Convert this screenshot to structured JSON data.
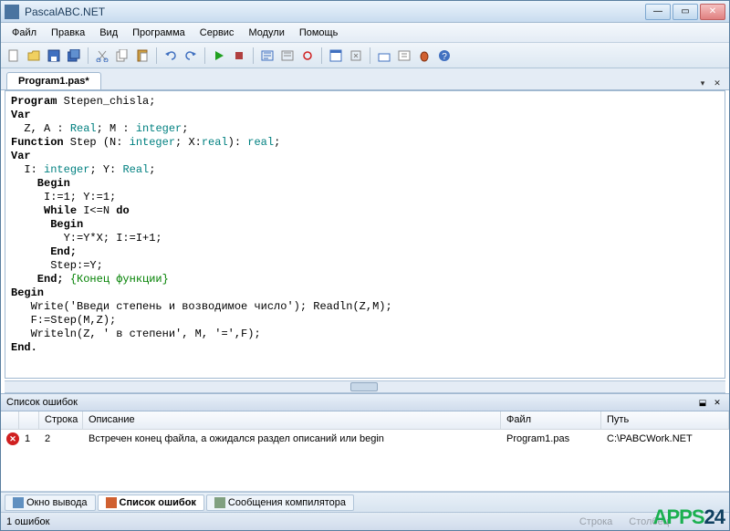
{
  "titlebar": {
    "title": "PascalABC.NET"
  },
  "menu": {
    "file": "Файл",
    "edit": "Правка",
    "view": "Вид",
    "program": "Программа",
    "service": "Сервис",
    "modules": "Модули",
    "help": "Помощь"
  },
  "tab": {
    "name": "Program1.pas*"
  },
  "code": {
    "l1a": "Program",
    "l1b": " Stepen_chisla;",
    "l2": "Var",
    "l3a": "  Z, A : ",
    "l3b": "Real",
    "l3c": "; M : ",
    "l3d": "integer",
    "l3e": ";",
    "l4a": "Function",
    "l4b": " Step (N: ",
    "l4c": "integer",
    "l4d": "; X:",
    "l4e": "real",
    "l4f": "): ",
    "l4g": "real",
    "l4h": ";",
    "l5": "Var",
    "l6a": "  I: ",
    "l6b": "integer",
    "l6c": "; Y: ",
    "l6d": "Real",
    "l6e": ";",
    "l7": "    Begin",
    "l8": "     I:=1; Y:=1;",
    "l9a": "     ",
    "l9b": "While",
    "l9c": " I<=N ",
    "l9d": "do",
    "l10": "      Begin",
    "l11": "        Y:=Y*X; I:=I+1;",
    "l12": "      End;",
    "l13": "      Step:=Y;",
    "l14a": "    End; ",
    "l14b": "{Конец функции}",
    "l15": "Begin",
    "l16": "   Write('Введи степень и возводимое число'); Readln(Z,M);",
    "l17": "   F:=Step(M,Z);",
    "l18": "   Writeln(Z, ' в степени', M, '=',F);",
    "l19": "End."
  },
  "errpanel": {
    "title": "Список ошибок",
    "headers": {
      "line": "Строка",
      "desc": "Описание",
      "file": "Файл",
      "path": "Путь"
    },
    "rows": [
      {
        "n": "1",
        "line": "2",
        "desc": "Встречен конец файла, а ожидался раздел описаний или begin",
        "file": "Program1.pas",
        "path": "C:\\PABCWork.NET"
      }
    ]
  },
  "tabs": {
    "output": "Окно вывода",
    "errors": "Список ошибок",
    "compiler": "Сообщения компилятора"
  },
  "status": {
    "left": "1 ошибок",
    "right1": "Строка",
    "right2": "Столбец"
  },
  "watermark": {
    "a": "APPS",
    "b": "24"
  }
}
